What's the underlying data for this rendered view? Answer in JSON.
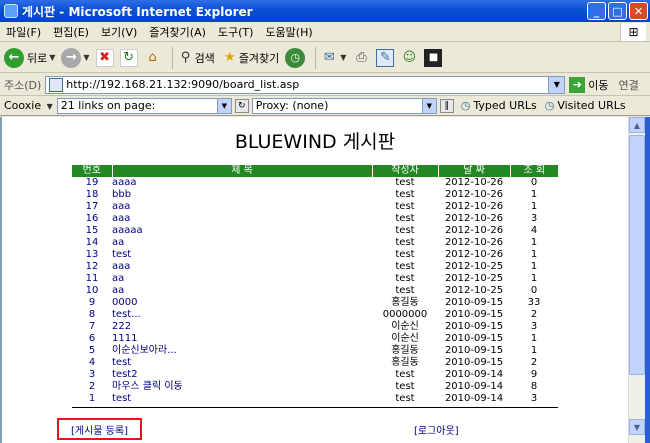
{
  "window": {
    "title": "게시판 - Microsoft Internet Explorer",
    "minimize": "_",
    "maximize": "□",
    "close": "✕"
  },
  "menu": [
    "파일(F)",
    "편집(E)",
    "보기(V)",
    "즐겨찾기(A)",
    "도구(T)",
    "도움말(H)"
  ],
  "toolbar": {
    "back_label": "뒤로",
    "search_label": "검색",
    "favorites_label": "즐겨찾기"
  },
  "address": {
    "label": "주소(D)",
    "url": "http://192.168.21.132:9090/board_list.asp",
    "go_label": "이동",
    "links_label": "연결"
  },
  "linksbar": {
    "cookie_label": "Cooxie",
    "links_dropdown": "21 links on page:",
    "proxy_dropdown": "Proxy: (none)",
    "typed_urls": "Typed URLs",
    "visited_urls": "Visited URLs"
  },
  "board": {
    "title": "BLUEWIND 게시판",
    "headers": [
      "번호",
      "제 목",
      "작성자",
      "날 짜",
      "조 회"
    ],
    "rows": [
      {
        "no": "19",
        "subject": "aaaa",
        "author": "test",
        "date": "2012-10-26",
        "views": "0"
      },
      {
        "no": "18",
        "subject": "bbb",
        "author": "test",
        "date": "2012-10-26",
        "views": "1"
      },
      {
        "no": "17",
        "subject": "aaa",
        "author": "test",
        "date": "2012-10-26",
        "views": "1"
      },
      {
        "no": "16",
        "subject": "aaa",
        "author": "test",
        "date": "2012-10-26",
        "views": "3"
      },
      {
        "no": "15",
        "subject": "aaaaa",
        "author": "test",
        "date": "2012-10-26",
        "views": "4"
      },
      {
        "no": "14",
        "subject": "aa",
        "author": "test",
        "date": "2012-10-26",
        "views": "1"
      },
      {
        "no": "13",
        "subject": "test",
        "author": "test",
        "date": "2012-10-26",
        "views": "1"
      },
      {
        "no": "12",
        "subject": "aaa",
        "author": "test",
        "date": "2012-10-25",
        "views": "1"
      },
      {
        "no": "11",
        "subject": "aa",
        "author": "test",
        "date": "2012-10-25",
        "views": "1"
      },
      {
        "no": "10",
        "subject": "aa",
        "author": "test",
        "date": "2012-10-25",
        "views": "0"
      },
      {
        "no": "9",
        "subject": "0000",
        "author": "홍길동",
        "date": "2010-09-15",
        "views": "33"
      },
      {
        "no": "8",
        "subject": "test...",
        "author": "0000000",
        "date": "2010-09-15",
        "views": "2"
      },
      {
        "no": "7",
        "subject": "222",
        "author": "이순신",
        "date": "2010-09-15",
        "views": "3"
      },
      {
        "no": "6",
        "subject": "1111",
        "author": "이순신",
        "date": "2010-09-15",
        "views": "1"
      },
      {
        "no": "5",
        "subject": "이순신보아라...",
        "author": "홍길동",
        "date": "2010-09-15",
        "views": "1"
      },
      {
        "no": "4",
        "subject": "test",
        "author": "홍길동",
        "date": "2010-09-15",
        "views": "2"
      },
      {
        "no": "3",
        "subject": "test2",
        "author": "test",
        "date": "2010-09-14",
        "views": "9"
      },
      {
        "no": "2",
        "subject": "마우스 클릭 이동",
        "author": "test",
        "date": "2010-09-14",
        "views": "8"
      },
      {
        "no": "1",
        "subject": "test",
        "author": "test",
        "date": "2010-09-14",
        "views": "3"
      }
    ],
    "register_label": "[게시물 등록]",
    "logout_label": "[로그아웃]"
  },
  "colors": {
    "header_green": "#228822",
    "link_navy": "#000080",
    "highlight_red": "#e8141a",
    "titlebar_blue": "#0a4fd4"
  }
}
